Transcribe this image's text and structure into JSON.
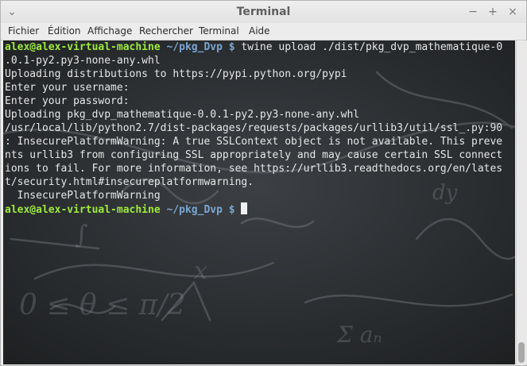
{
  "window": {
    "title": "Terminal",
    "buttons": [
      "⌄",
      "−",
      "+",
      "×"
    ]
  },
  "menu": [
    "Fichier",
    "Édition",
    "Affichage",
    "Rechercher",
    "Terminal",
    "Aide"
  ],
  "terminal": {
    "prompt_user": "alex@alex-virtual-machine",
    "prompt_path": "~/pkg_Dvp $",
    "command": " twine upload ./dist/pkg_dvp_mathematique-0",
    "output": [
      ".0.1-py2.py3-none-any.whl",
      "Uploading distributions to https://pypi.python.org/pypi",
      "Enter your username:",
      "Enter your password:",
      "Uploading pkg_dvp_mathematique-0.0.1-py2.py3-none-any.whl",
      "/usr/local/lib/python2.7/dist-packages/requests/packages/urllib3/util/ssl_.py:90",
      ": InsecurePlatformWarning: A true SSLContext object is not available. This preve",
      "nts urllib3 from configuring SSL appropriately and may cause certain SSL connect",
      "ions to fail. For more information, see https://urllib3.readthedocs.org/en/lates",
      "t/security.html#insecureplatformwarning.",
      "  InsecurePlatformWarning"
    ],
    "colors": {
      "user": "#9dea3c",
      "path": "#7ba6d3",
      "text": "#e6e6e6"
    }
  }
}
